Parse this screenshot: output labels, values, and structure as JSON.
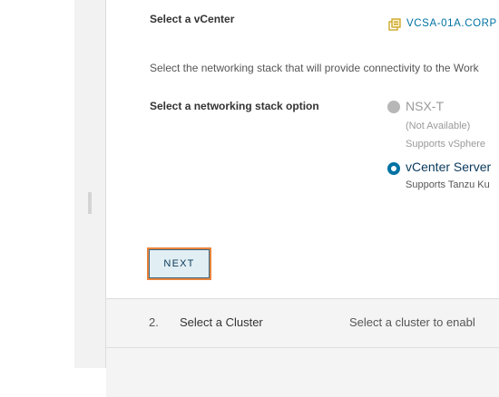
{
  "vcenter": {
    "label": "Select a vCenter",
    "value": "VCSA-01A.CORP",
    "icon": "vcenter-icon"
  },
  "networking": {
    "info": "Select the networking stack that will provide connectivity to the Work",
    "label": "Select a networking stack option",
    "options": [
      {
        "title": "NSX-T",
        "note": "(Not Available)",
        "subtitle": "Supports vSphere",
        "selected": false,
        "disabled": true
      },
      {
        "title": "vCenter Server",
        "subtitle": "Supports Tanzu Ku",
        "selected": true,
        "disabled": false
      }
    ]
  },
  "next_button": {
    "label": "NEXT"
  },
  "steps": [
    {
      "number": "2.",
      "title": "Select a Cluster",
      "description": "Select a cluster to enabl"
    }
  ],
  "colors": {
    "accent": "#0072a3",
    "focus": "#e8843c",
    "button_bg": "#e1eef3"
  }
}
